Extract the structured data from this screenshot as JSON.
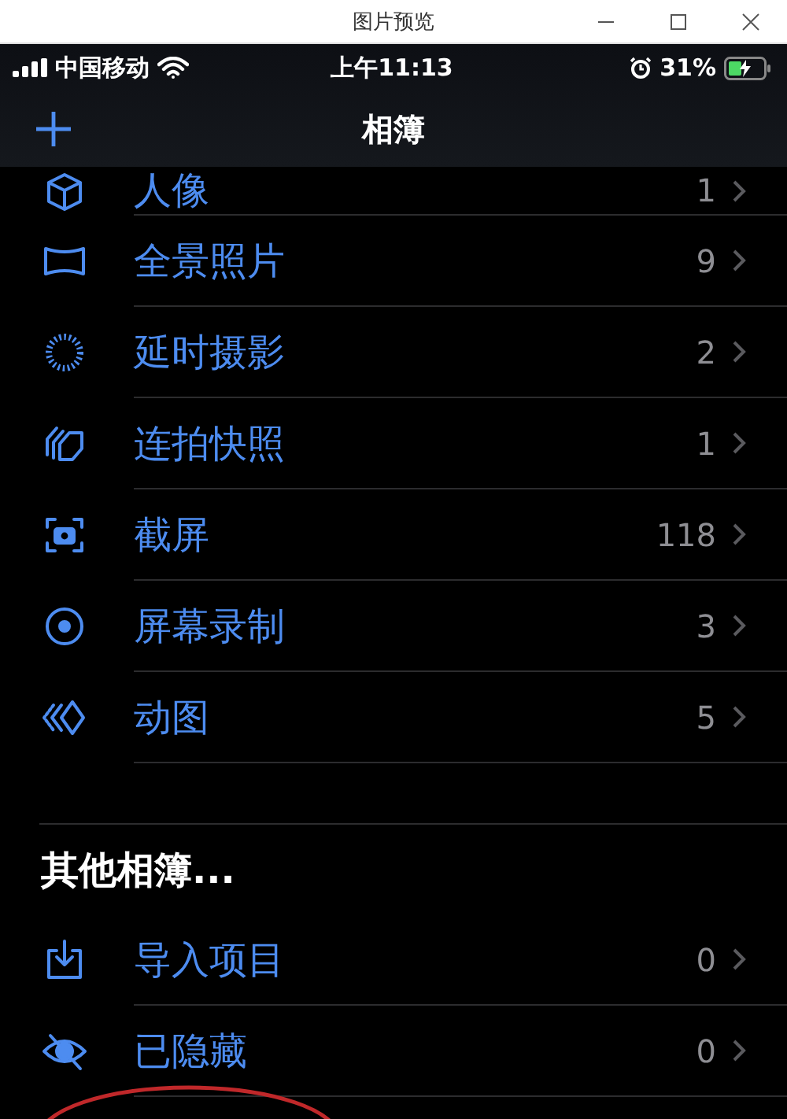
{
  "window": {
    "title": "图片预览"
  },
  "status_bar": {
    "carrier": "中国移动",
    "time": "上午11:13",
    "battery": "31%"
  },
  "nav_bar": {
    "title": "相簿"
  },
  "media_types": [
    {
      "label": "人像",
      "count": "1"
    },
    {
      "label": "全景照片",
      "count": "9"
    },
    {
      "label": "延时摄影",
      "count": "2"
    },
    {
      "label": "连拍快照",
      "count": "1"
    },
    {
      "label": "截屏",
      "count": "118"
    },
    {
      "label": "屏幕录制",
      "count": "3"
    },
    {
      "label": "动图",
      "count": "5"
    }
  ],
  "other_albums": {
    "heading": "其他相簿...",
    "items": [
      {
        "label": "导入项目",
        "count": "0"
      },
      {
        "label": "已隐藏",
        "count": "0"
      }
    ]
  }
}
